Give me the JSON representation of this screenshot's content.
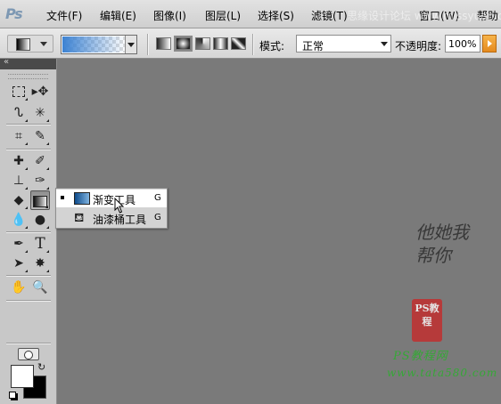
{
  "app": {
    "logo": "Ps"
  },
  "menu": [
    "文件(F)",
    "编辑(E)",
    "图像(I)",
    "图层(L)",
    "选择(S)",
    "滤镜(T)",
    "窗口(W)",
    "帮助"
  ],
  "top_watermark": "思缘设计论坛 www.missyuan.com",
  "options": {
    "gradient_types": [
      "linear-gradient-icon",
      "radial-gradient-icon",
      "angle-gradient-icon",
      "reflected-gradient-icon",
      "diamond-gradient-icon"
    ],
    "mode_label": "模式:",
    "mode_value": "正常",
    "opacity_label": "不透明度:",
    "opacity_value": "100%"
  },
  "toolbox": {
    "collapse_glyph": "«",
    "tools": [
      "rect-marquee-icon",
      "move-icon",
      "lasso-icon",
      "magic-wand-icon",
      "crop-icon",
      "eyedropper-icon",
      "healing-brush-icon",
      "brush-icon",
      "clone-stamp-icon",
      "history-brush-icon",
      "eraser-icon",
      "gradient-icon",
      "blur-icon",
      "dodge-icon",
      "pen-icon",
      "type-icon",
      "path-selection-icon",
      "shape-icon",
      "hand-icon",
      "zoom-icon"
    ],
    "foreground_color": "#ffffff",
    "background_color": "#000000"
  },
  "flyout": {
    "items": [
      {
        "label": "渐变工具",
        "key": "G",
        "icon": "gradient-tool-icon",
        "selected": true
      },
      {
        "label": "油漆桶工具",
        "key": "G",
        "icon": "paint-bucket-icon",
        "selected": false
      }
    ]
  },
  "watermark": {
    "poem": "他她我帮你",
    "seal": "PS教程",
    "site": "PS教程网",
    "url": "www.tata580.com"
  }
}
